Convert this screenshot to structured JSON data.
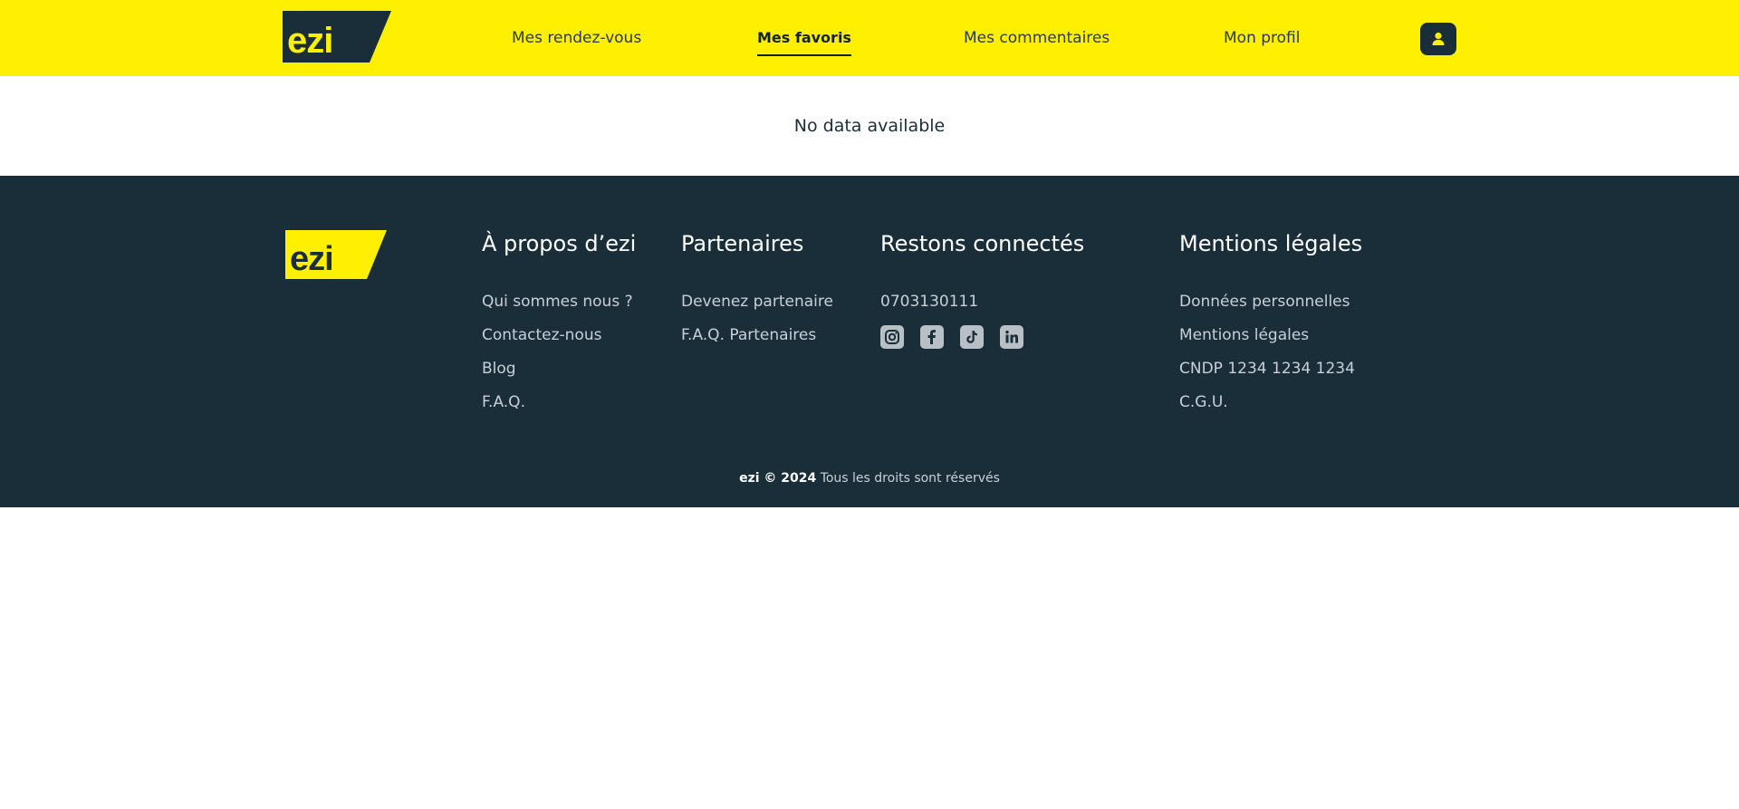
{
  "header": {
    "logo_text": "ezi",
    "nav": [
      {
        "label": "Mes rendez-vous",
        "active": false
      },
      {
        "label": "Mes favoris",
        "active": true
      },
      {
        "label": "Mes commentaires",
        "active": false
      },
      {
        "label": "Mon profil",
        "active": false
      }
    ],
    "user_icon": "user-icon"
  },
  "main": {
    "empty_message": "No data available"
  },
  "footer": {
    "logo_text": "ezi",
    "about": {
      "title": "À propos d’ezi",
      "links": [
        "Qui sommes nous ?",
        "Contactez-nous",
        "Blog",
        "F.A.Q."
      ]
    },
    "partners": {
      "title": "Partenaires",
      "links": [
        "Devenez partenaire",
        "F.A.Q. Partenaires"
      ]
    },
    "connect": {
      "title": "Restons connectés",
      "phone": "0703130111",
      "socials": [
        "instagram-icon",
        "facebook-icon",
        "tiktok-icon",
        "linkedin-icon"
      ]
    },
    "legal": {
      "title": "Mentions légales",
      "links": [
        "Données personnelles",
        "Mentions légales",
        "CNDP 1234 1234 1234",
        "C.G.U."
      ]
    },
    "copyright_brand": "ezi © 2024",
    "copyright_text": "Tous les droits sont réservés"
  },
  "colors": {
    "brand_yellow": "#ffef00",
    "dark_navy": "#1a2e3a"
  }
}
